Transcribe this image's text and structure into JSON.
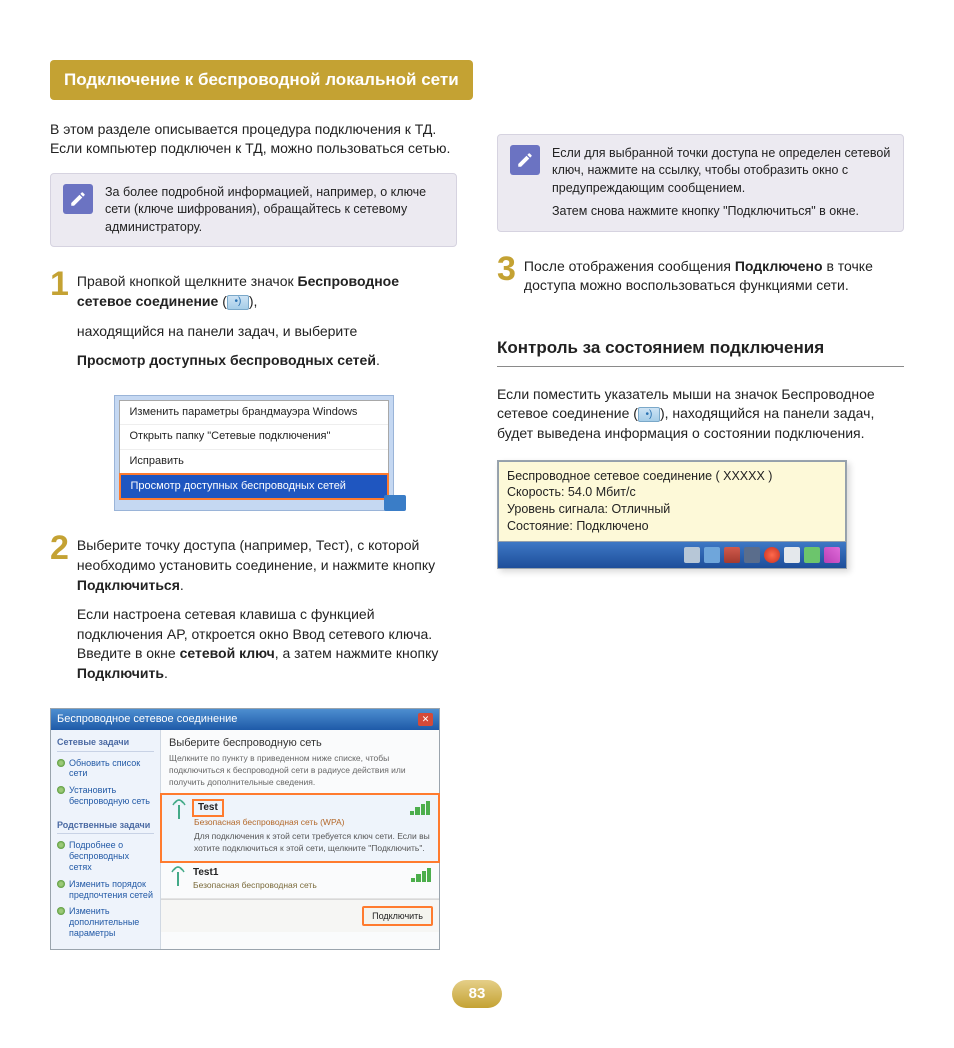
{
  "title": "Подключение к беспроводной локальной сети",
  "intro": "В этом разделе описывается процедура подключения к ТД. Если компьютер подключен к ТД, можно пользоваться сетью.",
  "note_left": "За более подробной информацией, например, о ключе сети (ключе шифрования), обращайтесь к сетевому администратору.",
  "step1": {
    "num": "1",
    "p1a": "Правой кнопкой щелкните значок ",
    "p1b": "Беспроводное сетевое соединение",
    "p1c": " (",
    "p1d": "),",
    "p2": "находящийся на панели задач, и выберите",
    "p3": "Просмотр доступных беспроводных сетей",
    "p3end": "."
  },
  "ctx_menu": {
    "i1": "Изменить параметры брандмауэра Windows",
    "i2": "Открыть папку \"Сетевые подключения\"",
    "i3": "Исправить",
    "i4": "Просмотр доступных беспроводных сетей"
  },
  "step2": {
    "num": "2",
    "p1a": "Выберите точку доступа (например, Тест), с которой необходимо установить соединение, и нажмите кнопку ",
    "p1b": "Подключиться",
    "p1c": ".",
    "p2a": "Если настроена сетевая клавиша с функцией подключения AP, откроется окно Ввод сетевого ключа. Введите в окне ",
    "p2b": "сетевой ключ",
    "p2c": ", а затем нажмите кнопку ",
    "p2d": "Подключить",
    "p2e": "."
  },
  "dialog": {
    "title": "Беспроводное сетевое соединение",
    "side_h1": "Сетевые задачи",
    "side_l1": "Обновить список сети",
    "side_l2": "Установить беспроводную сеть",
    "side_h2": "Родственные задачи",
    "side_l3": "Подробнее о беспроводных сетях",
    "side_l4": "Изменить порядок предпочтения сетей",
    "side_l5": "Изменить дополнительные параметры",
    "main_h": "Выберите беспроводную сеть",
    "main_sub": "Щелкните по пункту в приведенном ниже списке, чтобы подключиться к беспроводной сети в радиусе действия или получить дополнительные сведения.",
    "net1_name": "Test",
    "net1_sec": "Безопасная беспроводная сеть (WPA)",
    "net1_desc": "Для подключения к этой сети требуется ключ сети. Если вы хотите подключиться к этой сети, щелкните \"Подключить\".",
    "net2_name": "Test1",
    "net2_sec": "Безопасная беспроводная сеть",
    "btn": "Подключить"
  },
  "note_right": {
    "p1": "Если для выбранной точки доступа не определен сетевой ключ, нажмите на ссылку, чтобы отобразить окно с предупреждающим сообщением.",
    "p2": "Затем снова нажмите кнопку \"Подключиться\" в окне."
  },
  "step3": {
    "num": "3",
    "p1a": "После отображения сообщения ",
    "p1b": "Подключено",
    "p1c": " в точке доступа можно воспользоваться функциями сети."
  },
  "sub_heading": "Контроль за состоянием подключения",
  "monitor": {
    "p1a": "Если поместить указатель мыши на значок Беспроводное сетевое соединение (",
    "p1b": "), находящийся на панели задач, будет выведена информация о состоянии подключения."
  },
  "tooltip": {
    "l1": "Беспроводное сетевое соединение ( XXXXX  )",
    "l2": "Скорость: 54.0 Мбит/с",
    "l3": "Уровень сигнала: Отличный",
    "l4": "Состояние: Подключено"
  },
  "page_num": "83"
}
